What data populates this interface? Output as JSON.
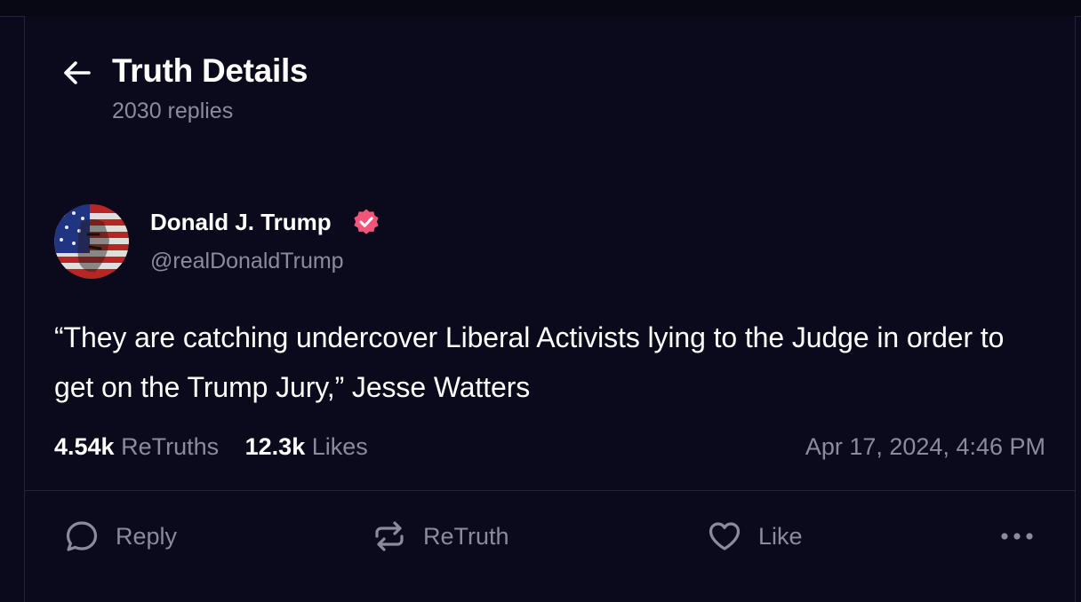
{
  "header": {
    "title": "Truth Details",
    "subtitle": "2030 replies"
  },
  "post": {
    "author_name": "Donald J. Trump",
    "author_handle": "@realDonaldTrump",
    "verified": true,
    "text": "“They are catching undercover Liberal Activists lying to the Judge in order to get on the Trump Jury,” Jesse Watters",
    "retruths_count": "4.54k",
    "retruths_label": "ReTruths",
    "likes_count": "12.3k",
    "likes_label": "Likes",
    "timestamp": "Apr 17, 2024, 4:46 PM"
  },
  "actions": {
    "reply_label": "Reply",
    "retruth_label": "ReTruth",
    "like_label": "Like"
  },
  "icons": {
    "back": "arrow-left-icon",
    "verified": "verified-badge-icon",
    "reply": "speech-bubble-icon",
    "retruth": "repost-arrows-icon",
    "like": "heart-icon",
    "more": "ellipsis-icon"
  },
  "colors": {
    "background": "#0a0a1c",
    "muted_text": "#8b8b9e",
    "verified_badge": "#f2557a",
    "divider": "#23233a"
  }
}
